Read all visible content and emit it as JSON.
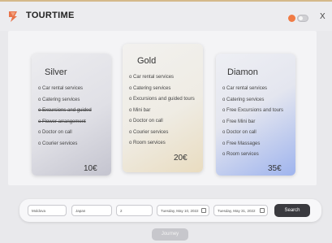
{
  "app": {
    "title": "TOURTIME",
    "close_label": "X"
  },
  "colors": {
    "accent": "#f07b45",
    "logo": "#e8734a",
    "search_button": "#3a3a3f"
  },
  "cards": [
    {
      "title": "Silver",
      "features": [
        "Car rental services",
        "Catering services",
        "Excursions and guided",
        "Flower arrangement",
        "Doctor on call",
        "Courier services"
      ],
      "struck": [
        false,
        false,
        true,
        true,
        false,
        false
      ],
      "price": "10€"
    },
    {
      "title": "Gold",
      "features": [
        "Car rental services",
        "Catering services",
        "Excursions and guided tours",
        "Mini bar",
        "Doctor on call",
        "Courier services",
        "Room services"
      ],
      "price": "20€"
    },
    {
      "title": "Diamon",
      "features": [
        "Car rental services",
        "Catering services",
        "Free Excursions and tours",
        "Free Mini bar",
        "Doctor on call",
        "Free Massages",
        "Room services"
      ],
      "price": "35€"
    }
  ],
  "search": {
    "from": "Moldova",
    "to": "Japan",
    "travelers": "2",
    "start_date": "Tuesday, May 10, 2022",
    "end_date": "Tuesday, May 31, 2022",
    "button_label": "Search"
  },
  "journey_button": "Journey"
}
